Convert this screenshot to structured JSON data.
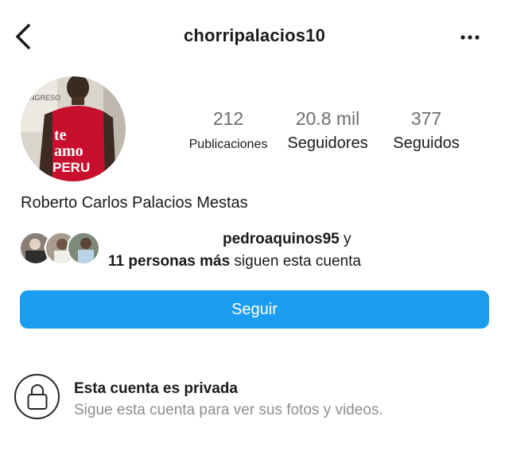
{
  "header": {
    "username": "chorripalacios10",
    "back_icon": "chevron-left-icon",
    "more_icon": "more-horizontal-icon"
  },
  "profile": {
    "full_name": "Roberto Carlos Palacios Mestas",
    "avatar_shirt_text_line1": "te",
    "avatar_shirt_text_line2": "amo",
    "avatar_shirt_text_line3": "PERU",
    "avatar_sign_text": "ONGRESO"
  },
  "stats": [
    {
      "value": "212",
      "label": "Publicaciones"
    },
    {
      "value": "20.8 mil",
      "label": "Seguidores"
    },
    {
      "value": "377",
      "label": "Seguidos"
    }
  ],
  "followed_by": {
    "user": "pedroaquinos95",
    "connector": " y",
    "others_bold": "11 personas más",
    "suffix": " siguen esta cuenta"
  },
  "follow_button": {
    "label": "Seguir",
    "color": "#1a9df0"
  },
  "private_notice": {
    "title": "Esta cuenta es privada",
    "subtitle": "Sigue esta cuenta para ver sus fotos y videos.",
    "icon": "lock-icon"
  }
}
